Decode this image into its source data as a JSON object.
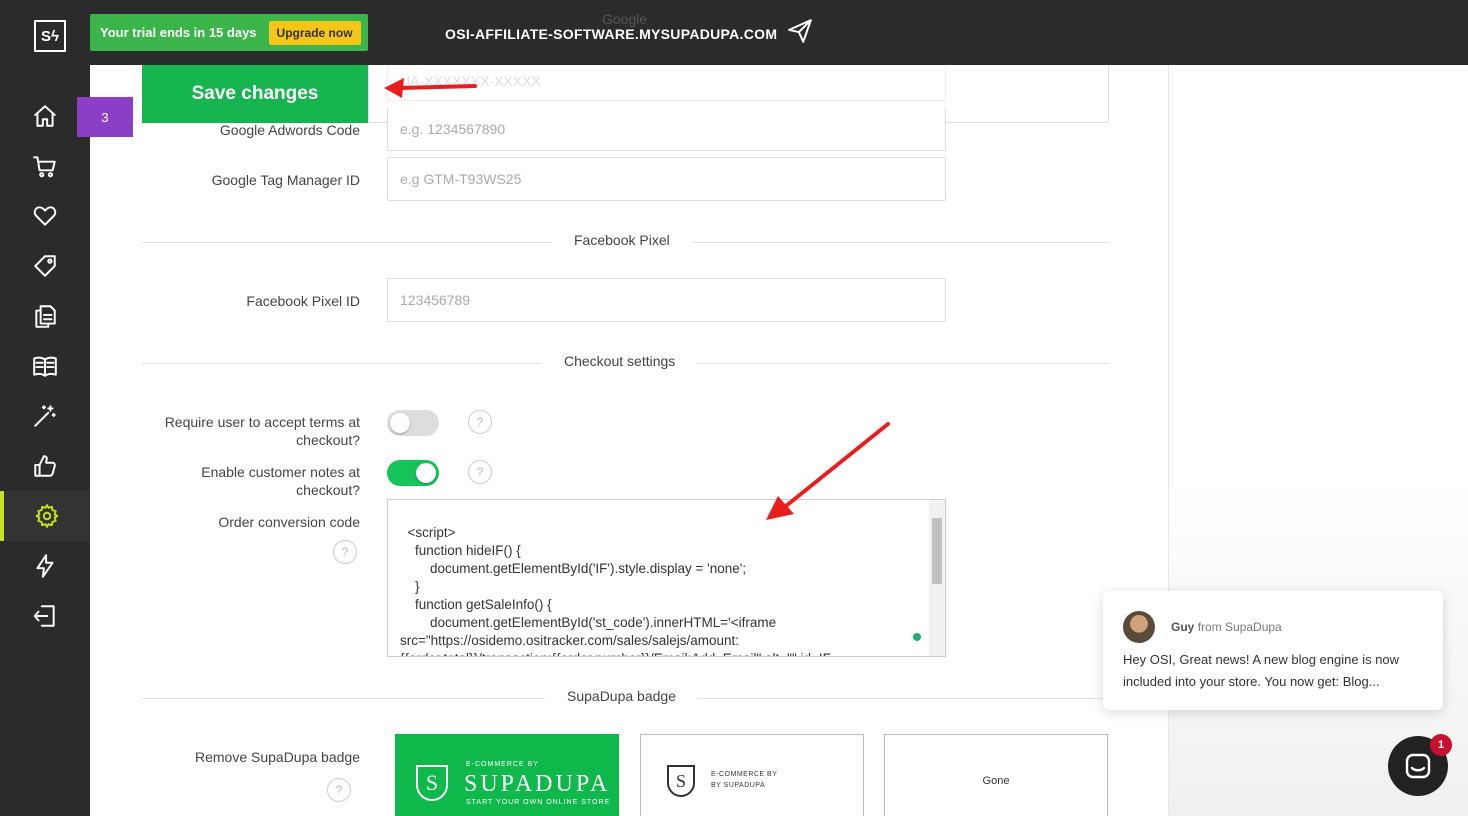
{
  "logo": "Sϟ",
  "sidebar": {
    "items": [
      {
        "icon": "home-icon"
      },
      {
        "icon": "cart-icon"
      },
      {
        "icon": "heart-icon"
      },
      {
        "icon": "tag-icon"
      },
      {
        "icon": "pages-icon"
      },
      {
        "icon": "book-icon"
      },
      {
        "icon": "magic-wand-icon"
      },
      {
        "icon": "thumbs-up-icon"
      },
      {
        "icon": "gear-icon",
        "active": true
      },
      {
        "icon": "lightning-icon"
      },
      {
        "icon": "logout-icon"
      }
    ]
  },
  "topbar": {
    "trial_text": "Your trial ends in 15 days",
    "upgrade_label": "Upgrade now",
    "domain": "OSI-AFFILIATE-SOFTWARE.MYSUPADUPA.COM",
    "ghost_heading": "Google"
  },
  "overlay": {
    "save_label": "Save changes",
    "step_number": "3",
    "ghost_placeholder": "UA-XXXXXXX-XXXXX"
  },
  "google": {
    "adwords_label": "Google Adwords Code",
    "adwords_placeholder": "e.g. 1234567890",
    "gtm_label": "Google Tag Manager ID",
    "gtm_placeholder": "e.g GTM-T93WS25"
  },
  "facebook": {
    "section_title": "Facebook Pixel",
    "pixel_label": "Facebook Pixel ID",
    "pixel_placeholder": "123456789"
  },
  "checkout": {
    "section_title": "Checkout settings",
    "terms_label": "Require user to accept terms at checkout?",
    "terms_enabled": false,
    "notes_label": "Enable customer notes at checkout?",
    "notes_enabled": true,
    "conversion_label": "Order conversion code",
    "help_glyph": "?",
    "conversion_code": "<script>\n    function hideIF() {\n        document.getElementById('IF').style.display = 'none';\n    }\n    function getSaleInfo() {\n        document.getElementById('st_code').innerHTML='<iframe\nsrc=\"https://osidemo.ositracker.com/sales/salejs/amount:\n{{order.total}}/transaction:{{order.number}}/Email:Add_Email\" alt=\"\" id=IF\n width=50 height=50 border=\"0\" frameborder=\"0\" onload=\"hideIF()\">'"
  },
  "badge": {
    "section_title": "SupaDupa badge",
    "remove_label": "Remove SupaDupa badge",
    "card1_top": "E-COMMERCE BY",
    "card1_brand": "SUPADUPA",
    "card1_bottom": "START YOUR OWN ONLINE STORE",
    "card2_line1": "E-COMMERCE BY",
    "card2_line2": "BY SUPADUPA",
    "card3_label": "Gone"
  },
  "chat": {
    "sender": "Guy",
    "sender_suffix": "from SupaDupa",
    "message": "Hey OSI, Great news! A new blog engine is now included into your store.  You now get: Blog...",
    "unread_count": "1"
  }
}
